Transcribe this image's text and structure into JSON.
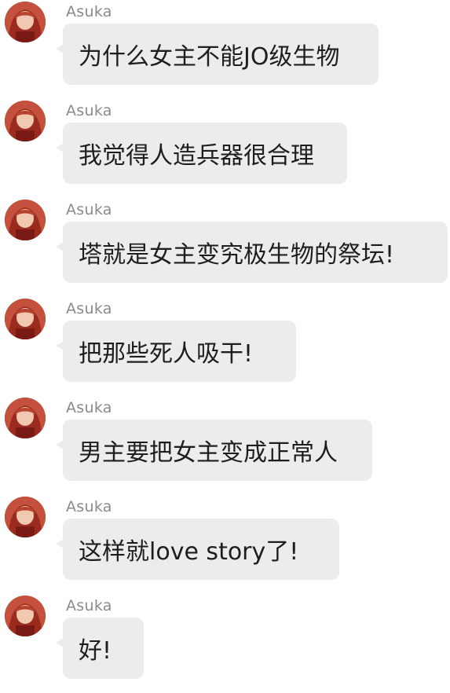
{
  "messages": [
    {
      "sender": "Asuka",
      "text": "为什么女主不能JO级生物",
      "avatar_icon": "user-avatar-icon"
    },
    {
      "sender": "Asuka",
      "text": "我觉得人造兵器很合理",
      "avatar_icon": "user-avatar-icon"
    },
    {
      "sender": "Asuka",
      "text": "塔就是女主变究极生物的祭坛!",
      "avatar_icon": "user-avatar-icon"
    },
    {
      "sender": "Asuka",
      "text": "把那些死人吸干!",
      "avatar_icon": "user-avatar-icon"
    },
    {
      "sender": "Asuka",
      "text": "男主要把女主变成正常人",
      "avatar_icon": "user-avatar-icon"
    },
    {
      "sender": "Asuka",
      "text": "这样就love story了!",
      "avatar_icon": "user-avatar-icon"
    },
    {
      "sender": "Asuka",
      "text": "好!",
      "avatar_icon": "user-avatar-icon"
    }
  ],
  "colors": {
    "bubble_background": "#ececec",
    "sender_name": "#8a8a8a",
    "message_text": "#1e1e1e",
    "page_background": "#ffffff"
  }
}
